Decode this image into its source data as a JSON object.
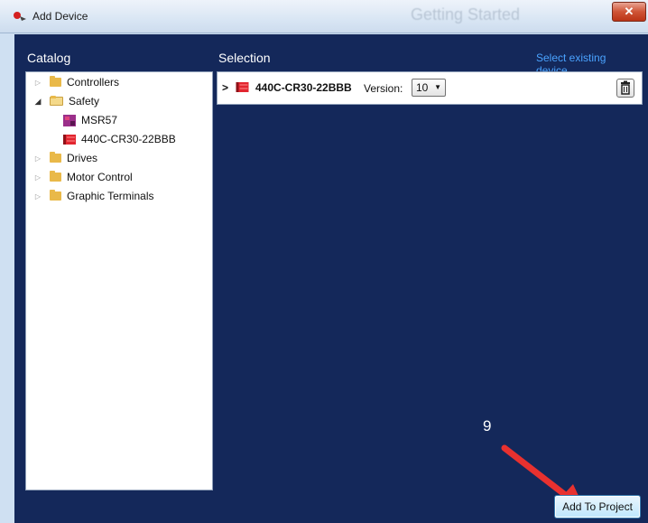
{
  "window": {
    "title": "Add Device",
    "background_title": "Getting Started"
  },
  "catalog": {
    "label": "Catalog",
    "items": [
      {
        "label": "Controllers",
        "type": "folder",
        "expanded": false
      },
      {
        "label": "Safety",
        "type": "folder",
        "expanded": true
      },
      {
        "label": "MSR57",
        "type": "device"
      },
      {
        "label": "440C-CR30-22BBB",
        "type": "device"
      },
      {
        "label": "Drives",
        "type": "folder",
        "expanded": false
      },
      {
        "label": "Motor Control",
        "type": "folder",
        "expanded": false
      },
      {
        "label": "Graphic Terminals",
        "type": "folder",
        "expanded": false
      }
    ]
  },
  "selection": {
    "label": "Selection",
    "select_existing": "Select existing device...",
    "device_name": "440C-CR30-22BBB",
    "version_label": "Version:",
    "version_value": "10"
  },
  "annotation": {
    "step": "9"
  },
  "footer": {
    "add_button": "Add To Project"
  },
  "colors": {
    "panel_bg": "#14285a",
    "link": "#4aa3ff",
    "arrow": "#e8312f"
  }
}
